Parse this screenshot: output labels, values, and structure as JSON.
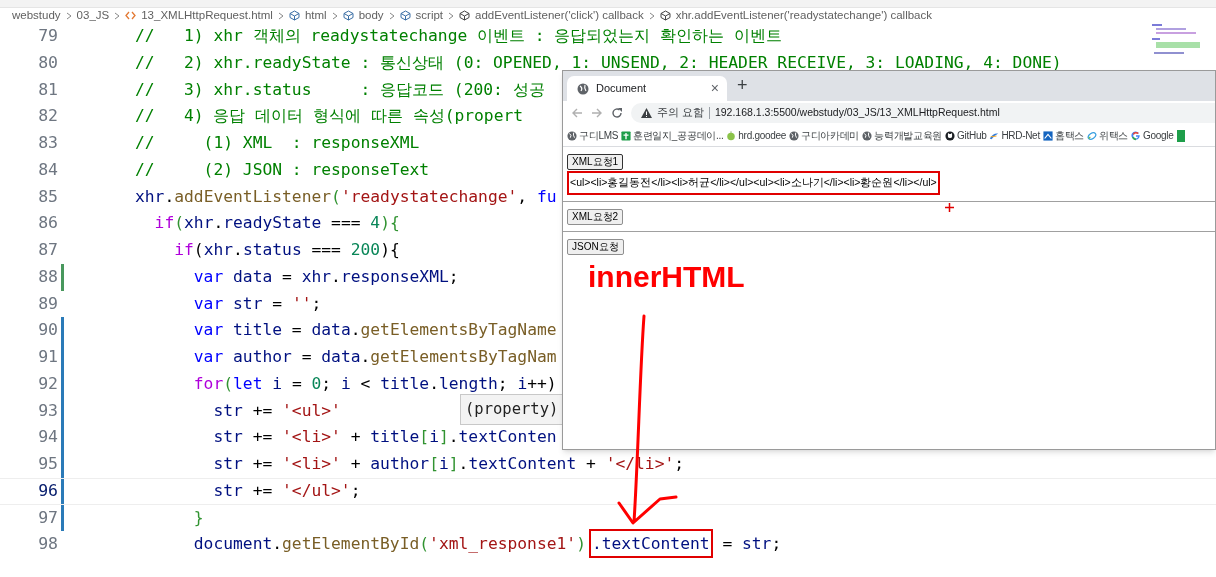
{
  "breadcrumb": [
    "webstudy",
    "03_JS",
    "13_XMLHttpRequest.html",
    "html",
    "body",
    "script",
    "addEventListener('click') callback",
    "xhr.addEventListener('readystatechange') callback"
  ],
  "editor": {
    "lines": [
      {
        "number": "79",
        "current": false,
        "tokens": [
          {
            "kind": "comment",
            "text": "//   1) xhr 객체의 readystatechange 이벤트 : 응답되었는지 확인하는 이벤트"
          }
        ]
      },
      {
        "number": "80",
        "current": false,
        "tokens": [
          {
            "kind": "comment",
            "text": "//   2) xhr.readyState : 통신상태 (0: OPENED, 1: UNSEND, 2: HEADER RECEIVE, 3: LOADING, 4: DONE)"
          }
        ]
      },
      {
        "number": "81",
        "current": false,
        "tokens": [
          {
            "kind": "comment",
            "text": "//   3) xhr.status     : 응답코드 (200: 성공"
          }
        ]
      },
      {
        "number": "82",
        "current": false,
        "tokens": [
          {
            "kind": "comment",
            "text": "//   4) 응답 데이터 형식에 따른 속성(propert"
          }
        ]
      },
      {
        "number": "83",
        "current": false,
        "tokens": [
          {
            "kind": "comment",
            "text": "//     (1) XML  : responseXML"
          }
        ]
      },
      {
        "number": "84",
        "current": false,
        "tokens": [
          {
            "kind": "comment",
            "text": "//     (2) JSON : responseText"
          }
        ]
      },
      {
        "number": "85",
        "current": false,
        "tokens": [
          {
            "kind": "var",
            "text": "xhr"
          },
          {
            "kind": "plain",
            "text": "."
          },
          {
            "kind": "func",
            "text": "addEventListener"
          },
          {
            "kind": "bracket",
            "text": "("
          },
          {
            "kind": "string",
            "text": "'readystatechange'"
          },
          {
            "kind": "plain",
            "text": ", "
          },
          {
            "kind": "storage",
            "text": "fu"
          }
        ]
      },
      {
        "number": "86",
        "current": false,
        "tokens": [
          {
            "kind": "control",
            "text": "  if"
          },
          {
            "kind": "bracket",
            "text": "("
          },
          {
            "kind": "var",
            "text": "xhr"
          },
          {
            "kind": "plain",
            "text": "."
          },
          {
            "kind": "var",
            "text": "readyState"
          },
          {
            "kind": "plain",
            "text": " === "
          },
          {
            "kind": "number",
            "text": "4"
          },
          {
            "kind": "bracket",
            "text": "){"
          }
        ]
      },
      {
        "number": "87",
        "current": false,
        "tokens": [
          {
            "kind": "control",
            "text": "    if"
          },
          {
            "kind": "plain",
            "text": "("
          },
          {
            "kind": "var",
            "text": "xhr"
          },
          {
            "kind": "plain",
            "text": "."
          },
          {
            "kind": "var",
            "text": "status"
          },
          {
            "kind": "plain",
            "text": " === "
          },
          {
            "kind": "number",
            "text": "200"
          },
          {
            "kind": "plain",
            "text": "){"
          }
        ]
      },
      {
        "number": "88",
        "color": "#48985d",
        "current": false,
        "tokens": [
          {
            "kind": "storage",
            "text": "      var "
          },
          {
            "kind": "var",
            "text": "data"
          },
          {
            "kind": "plain",
            "text": " = "
          },
          {
            "kind": "var",
            "text": "xhr"
          },
          {
            "kind": "plain",
            "text": "."
          },
          {
            "kind": "var",
            "text": "responseXML"
          },
          {
            "kind": "plain",
            "text": ";"
          }
        ]
      },
      {
        "number": "89",
        "current": false,
        "tokens": [
          {
            "kind": "storage",
            "text": "      var "
          },
          {
            "kind": "var",
            "text": "str"
          },
          {
            "kind": "plain",
            "text": " = "
          },
          {
            "kind": "string",
            "text": "''"
          },
          {
            "kind": "plain",
            "text": ";"
          }
        ]
      },
      {
        "number": "90",
        "color": "#2a7ab8",
        "current": false,
        "tokens": [
          {
            "kind": "storage",
            "text": "      var "
          },
          {
            "kind": "var",
            "text": "title"
          },
          {
            "kind": "plain",
            "text": " = "
          },
          {
            "kind": "var",
            "text": "data"
          },
          {
            "kind": "plain",
            "text": "."
          },
          {
            "kind": "func",
            "text": "getElementsByTagName"
          }
        ]
      },
      {
        "number": "91",
        "color": "#2a7ab8",
        "current": false,
        "tokens": [
          {
            "kind": "storage",
            "text": "      var "
          },
          {
            "kind": "var",
            "text": "author"
          },
          {
            "kind": "plain",
            "text": " = "
          },
          {
            "kind": "var",
            "text": "data"
          },
          {
            "kind": "plain",
            "text": "."
          },
          {
            "kind": "func",
            "text": "getElementsByTagNam"
          }
        ]
      },
      {
        "number": "92",
        "color": "#2a7ab8",
        "current": false,
        "tokens": [
          {
            "kind": "control",
            "text": "      for"
          },
          {
            "kind": "bracket",
            "text": "("
          },
          {
            "kind": "storage",
            "text": "let "
          },
          {
            "kind": "var",
            "text": "i"
          },
          {
            "kind": "plain",
            "text": " = "
          },
          {
            "kind": "number",
            "text": "0"
          },
          {
            "kind": "plain",
            "text": "; "
          },
          {
            "kind": "var",
            "text": "i"
          },
          {
            "kind": "plain",
            "text": " < "
          },
          {
            "kind": "var",
            "text": "title"
          },
          {
            "kind": "plain",
            "text": "."
          },
          {
            "kind": "var",
            "text": "length"
          },
          {
            "kind": "plain",
            "text": "; "
          },
          {
            "kind": "var",
            "text": "i"
          },
          {
            "kind": "plain",
            "text": "++)"
          }
        ]
      },
      {
        "number": "93",
        "color": "#2a7ab8",
        "current": false,
        "tokens": [
          {
            "kind": "var",
            "text": "        str"
          },
          {
            "kind": "plain",
            "text": " += "
          },
          {
            "kind": "string",
            "text": "'<ul>'"
          }
        ]
      },
      {
        "number": "94",
        "color": "#2a7ab8",
        "current": false,
        "tokens": [
          {
            "kind": "var",
            "text": "        str"
          },
          {
            "kind": "plain",
            "text": " += "
          },
          {
            "kind": "string",
            "text": "'<li>'"
          },
          {
            "kind": "plain",
            "text": " + "
          },
          {
            "kind": "var",
            "text": "title"
          },
          {
            "kind": "bracket",
            "text": "["
          },
          {
            "kind": "var",
            "text": "i"
          },
          {
            "kind": "bracket",
            "text": "]"
          },
          {
            "kind": "plain",
            "text": "."
          },
          {
            "kind": "var",
            "text": "textConten"
          }
        ]
      },
      {
        "number": "95",
        "color": "#2a7ab8",
        "current": false,
        "tokens": [
          {
            "kind": "var",
            "text": "        str"
          },
          {
            "kind": "plain",
            "text": " += "
          },
          {
            "kind": "string",
            "text": "'<li>'"
          },
          {
            "kind": "plain",
            "text": " + "
          },
          {
            "kind": "var",
            "text": "author"
          },
          {
            "kind": "bracket",
            "text": "["
          },
          {
            "kind": "var",
            "text": "i"
          },
          {
            "kind": "bracket",
            "text": "]"
          },
          {
            "kind": "plain",
            "text": "."
          },
          {
            "kind": "var",
            "text": "textContent"
          },
          {
            "kind": "plain",
            "text": " + "
          },
          {
            "kind": "string",
            "text": "'</li>'"
          },
          {
            "kind": "plain",
            "text": ";"
          }
        ]
      },
      {
        "number": "96",
        "color": "#2a7ab8",
        "current": true,
        "tokens": [
          {
            "kind": "var",
            "text": "        str"
          },
          {
            "kind": "plain",
            "text": " += "
          },
          {
            "kind": "string",
            "text": "'</ul>'"
          },
          {
            "kind": "plain",
            "text": ";"
          }
        ]
      },
      {
        "number": "97",
        "color": "#2a7ab8",
        "current": false,
        "tokens": [
          {
            "kind": "bracket",
            "text": "      }"
          }
        ]
      },
      {
        "number": "98",
        "current": false,
        "tokens": [
          {
            "kind": "var",
            "text": "      document"
          },
          {
            "kind": "plain",
            "text": "."
          },
          {
            "kind": "func",
            "text": "getElementById"
          },
          {
            "kind": "bracket",
            "text": "("
          },
          {
            "kind": "string",
            "text": "'xml_response1'"
          },
          {
            "kind": "bracket",
            "text": ")"
          },
          {
            "kind": "boxed",
            "text": ".textContent"
          },
          {
            "kind": "plain",
            "text": " = "
          },
          {
            "kind": "var",
            "text": "str"
          },
          {
            "kind": "plain",
            "text": ";"
          }
        ]
      }
    ]
  },
  "tooltip": "(property)",
  "browser": {
    "tab": "Document",
    "tab_close": "×",
    "new_tab": "+",
    "security": "주의 요함",
    "url": "192.168.1.3:5500/webstudy/03_JS/13_XMLHttpRequest.html",
    "bookmarks": [
      "구디LMS",
      "훈련일지_공공데이...",
      "hrd.goodee",
      "구디아카데미",
      "능력개발교육원",
      "GitHub",
      "HRD-Net",
      "홈택스",
      "위택스",
      "Google"
    ],
    "sections": [
      {
        "button": "XML요청1",
        "focused": true,
        "output": "<ul><li>홍길동전</li><li>허균</li></ul><ul><li>소나기</li><li>황순원</li></ul>",
        "highlighted": true
      },
      {
        "button": "XML요청2",
        "focused": false
      },
      {
        "button": "JSON요청",
        "focused": false
      }
    ]
  },
  "annotation": "innerHTML"
}
